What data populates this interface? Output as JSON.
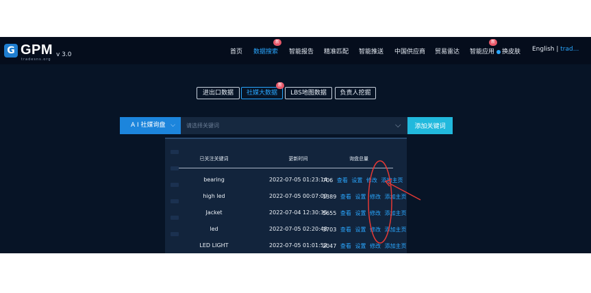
{
  "header": {
    "logo_text": "GPM",
    "logo_sub": "tradesns.org",
    "version": "v 3.0",
    "nav": [
      {
        "label": "首页"
      },
      {
        "label": "数据搜索",
        "badge": "新"
      },
      {
        "label": "智能报告"
      },
      {
        "label": "精准匹配"
      },
      {
        "label": "智能推送"
      },
      {
        "label": "中国供应商"
      },
      {
        "label": "贸易雷达"
      },
      {
        "label": "智能应用",
        "badge": "新"
      },
      {
        "label": "换皮肤"
      }
    ],
    "language": "English |",
    "user": "trad..."
  },
  "tabs": [
    {
      "label": "进出口数据"
    },
    {
      "label": "社媒大数据",
      "badge": "新"
    },
    {
      "label": "LBS地图数据"
    },
    {
      "label": "负责人挖掘"
    }
  ],
  "search": {
    "type_label": "A I 社媒询盘",
    "placeholder": "请选择关键词",
    "add_button": "添加关键词"
  },
  "table": {
    "headers": [
      "已关注关键词",
      "更新时间",
      "询盘总量"
    ],
    "actions": [
      "查看",
      "设置",
      "修改",
      "添加主页"
    ],
    "rows": [
      {
        "keyword": "bearing",
        "time": "2022-07-05 01:23:14",
        "count": "706"
      },
      {
        "keyword": "high led",
        "time": "2022-07-05 00:07:09",
        "count": "1389"
      },
      {
        "keyword": "Jacket",
        "time": "2022-07-04 12:30:35",
        "count": "5655"
      },
      {
        "keyword": "led",
        "time": "2022-07-05 02:20:48",
        "count": "3703"
      },
      {
        "keyword": "LED LIGHT",
        "time": "2022-07-05 01:01:52",
        "count": "2047"
      }
    ]
  },
  "colors": {
    "background": "#071426",
    "accent": "#2aa7ff",
    "primary_button": "#1c85dc",
    "add_button": "#21b9dd",
    "badge": "#e9596a",
    "annotation": "#e53935"
  }
}
